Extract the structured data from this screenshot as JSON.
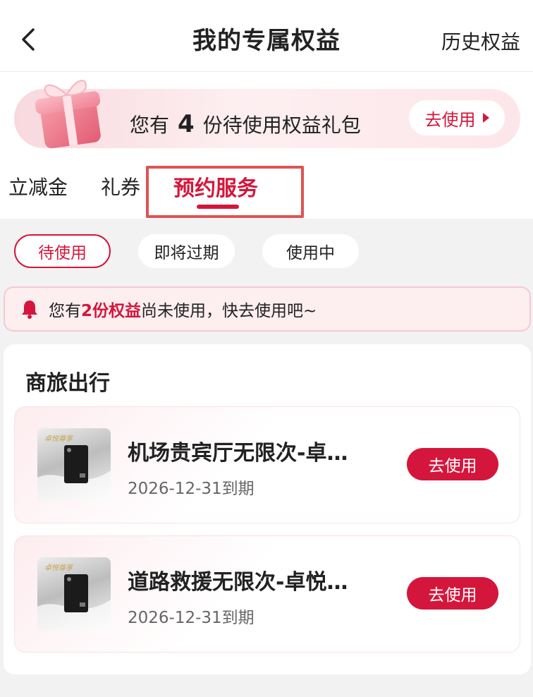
{
  "navbar": {
    "title": "我的专属权益",
    "history_link": "历史权益",
    "back_icon": "chevron-left-icon"
  },
  "banner": {
    "prefix": "您有",
    "count": "4",
    "suffix": "份待使用权益礼包",
    "button_label": "去使用",
    "gift_icon": "gift-box-icon"
  },
  "tabs": [
    {
      "label": "立减金",
      "active": false
    },
    {
      "label": "礼券",
      "active": false
    },
    {
      "label": "预约服务",
      "active": true
    }
  ],
  "filters": [
    {
      "label": "待使用",
      "active": true
    },
    {
      "label": "即将过期",
      "active": false
    },
    {
      "label": "使用中",
      "active": false
    }
  ],
  "notice": {
    "prefix": "您有",
    "highlight": "2份权益",
    "suffix": "尚未使用，快去使用吧~",
    "bell_icon": "bell-icon"
  },
  "section": {
    "title": "商旅出行",
    "items": [
      {
        "name": "机场贵宾厅无限次-卓…",
        "expiry": "2026-12-31到期",
        "button": "去使用"
      },
      {
        "name": "道路救援无限次-卓悦…",
        "expiry": "2026-12-31到期",
        "button": "去使用"
      }
    ]
  },
  "colors": {
    "accent": "#d4163c",
    "page_bg": "#f2f2f2",
    "highlight_box": "#e05252"
  }
}
